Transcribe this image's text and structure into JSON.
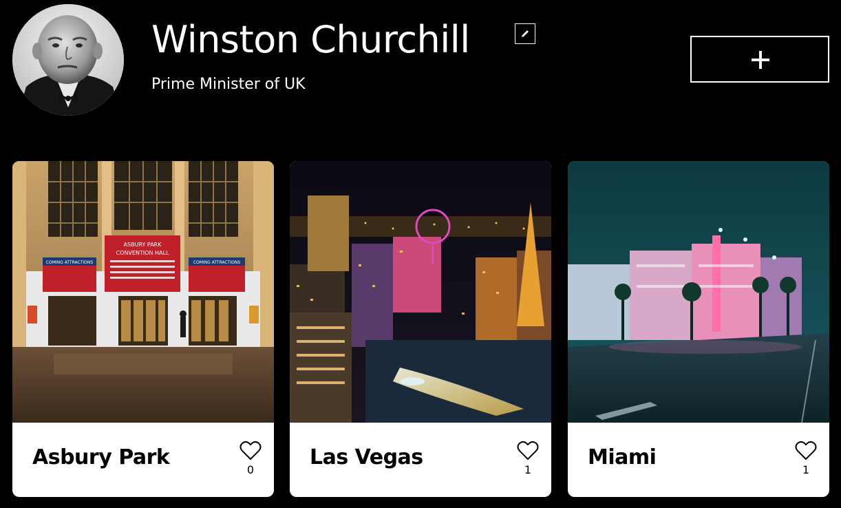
{
  "profile": {
    "name": "Winston Churchill",
    "about": "Prime Minister of UK",
    "avatar_icon": "portrait-photo",
    "edit_icon": "pencil-icon",
    "add_icon": "plus-icon"
  },
  "cards": [
    {
      "title": "Asbury Park",
      "likes": "0",
      "image": "convention-hall-photo",
      "image_signs": {
        "main": [
          "ASBURY PARK",
          "CONVENTION HALL"
        ],
        "left": "COMING ATTRACTIONS",
        "right": "COMING ATTRACTIONS"
      }
    },
    {
      "title": "Las Vegas",
      "likes": "1",
      "image": "las-vegas-night-photo"
    },
    {
      "title": "Miami",
      "likes": "1",
      "image": "miami-street-night-photo"
    }
  ],
  "colors": {
    "background": "#000000",
    "card": "#ffffff",
    "text_light": "#ffffff",
    "text_dark": "#000000"
  }
}
